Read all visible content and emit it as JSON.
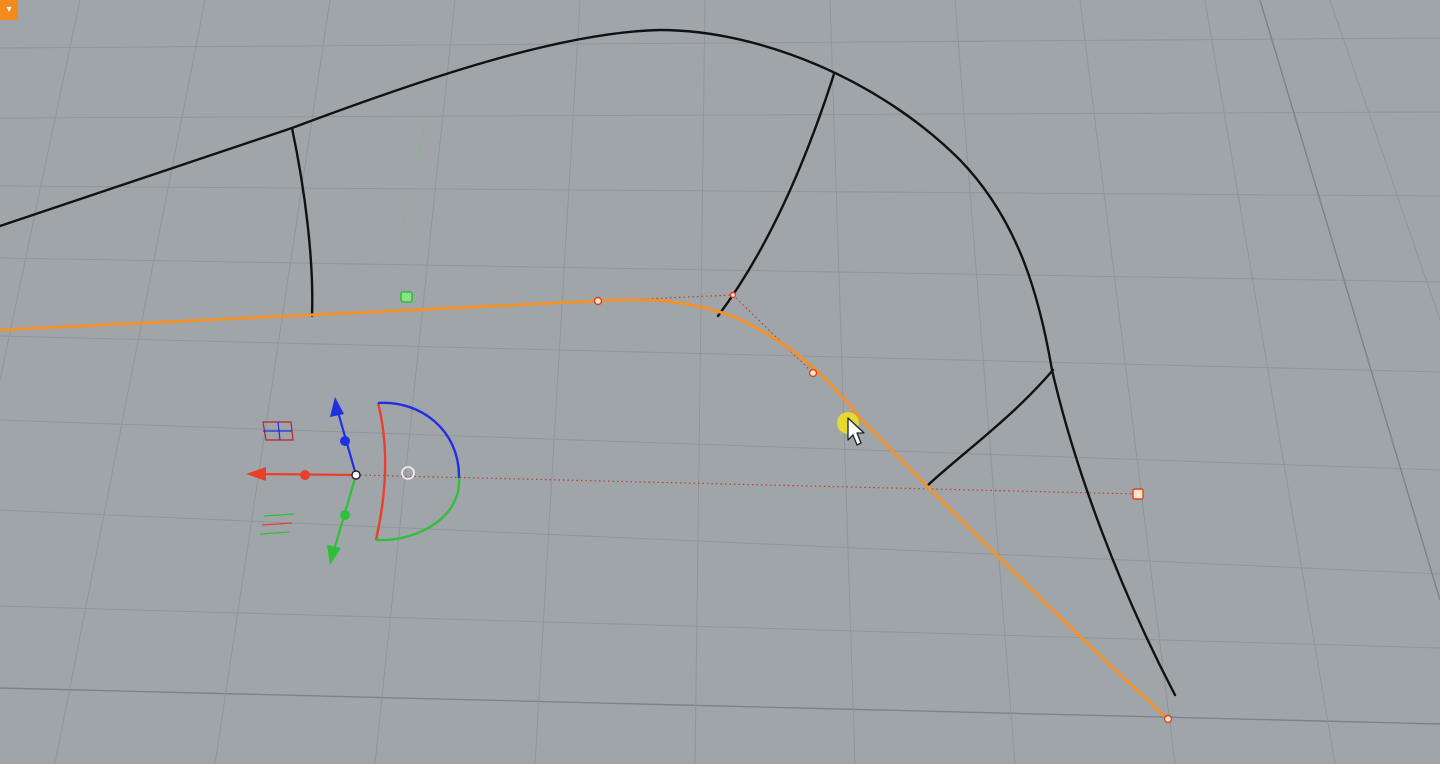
{
  "viewport": {
    "menu_icon": "viewport-menu-icon",
    "background_color": "#a0a5aa",
    "grid_color": "#8f959a",
    "grid_major_color": "#7d8287",
    "curve_color": "#111111",
    "selected_curve_color": "#f0922e",
    "control_polygon_color": "#c0392b",
    "gumball": {
      "x_axis_color": "#e8402a",
      "y_axis_color": "#2fbf3a",
      "z_axis_color": "#2030e0"
    },
    "cursor": {
      "icon": "mouse-pointer-icon",
      "highlight_color": "#f2e21a"
    }
  }
}
